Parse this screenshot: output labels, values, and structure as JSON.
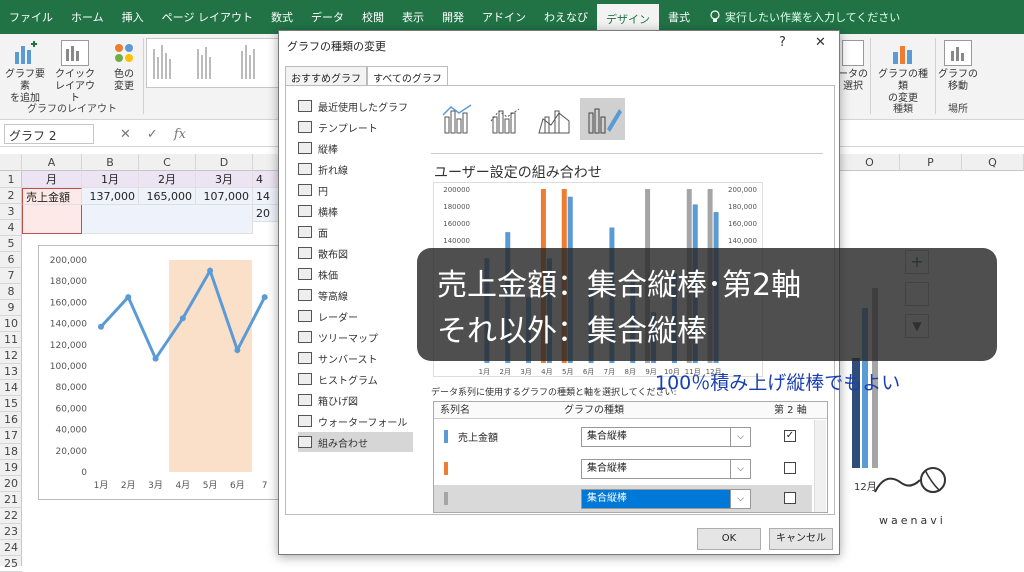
{
  "ribbon": {
    "tabs": [
      "ファイル",
      "ホーム",
      "挿入",
      "ページ レイアウト",
      "数式",
      "データ",
      "校閲",
      "表示",
      "開発",
      "アドイン",
      "わえなび",
      "デザイン",
      "書式"
    ],
    "selected_tab": "デザイン",
    "tell_me": "実行したい作業を入力してください",
    "add_element": "グラフ要素\nを追加",
    "quick_layout": "クイック\nレイアウト",
    "change_colors": "色の\n変更",
    "layout_group": "グラフのレイアウト",
    "select_data_partial": "ータの\n選択",
    "change_type": "グラフの種類\nの変更",
    "type_group": "種類",
    "move_chart": "グラフの\n移動",
    "location_group": "場所"
  },
  "formula_bar": {
    "name_box": "グラフ 2",
    "cancel": "✕",
    "enter": "✓",
    "fx": "fx"
  },
  "sheet": {
    "columns": [
      "A",
      "B",
      "C",
      "D",
      "O",
      "P",
      "Q"
    ],
    "rows": [
      "1",
      "2",
      "3",
      "4",
      "5",
      "6",
      "7",
      "8",
      "9",
      "10",
      "11",
      "12",
      "13",
      "14",
      "15",
      "16",
      "17",
      "18",
      "19",
      "20",
      "21",
      "22",
      "23",
      "24",
      "25"
    ],
    "a1": "月",
    "b1": "1月",
    "c1": "2月",
    "d1": "3月",
    "e1": "4",
    "a2": "売上金額",
    "b2": "137,000",
    "c2": "165,000",
    "d2": "107,000",
    "e2": "14",
    "e3": "20"
  },
  "chart_data": {
    "type": "line",
    "categories": [
      "1月",
      "2月",
      "3月",
      "4月",
      "5月",
      "6月",
      "7"
    ],
    "values": [
      137000,
      165000,
      107000,
      145000,
      190000,
      115000,
      165000
    ],
    "yticks": [
      "200,000",
      "180,000",
      "160,000",
      "140,000",
      "120,000",
      "100,000",
      "80,000",
      "60,000",
      "40,000",
      "20,000",
      "0"
    ],
    "ylim": [
      0,
      200000
    ],
    "highlight_range": [
      "4月",
      "6月"
    ],
    "line_color": "#5b9bd5",
    "highlight_color": "#fbe0c9"
  },
  "dialog": {
    "title": "グラフの種類の変更",
    "help": "?",
    "close": "✕",
    "tabs": [
      "おすすめグラフ",
      "すべてのグラフ"
    ],
    "selected_tab": "すべてのグラフ",
    "nav": [
      {
        "label": "最近使用したグラフ",
        "icon": "undo-icon"
      },
      {
        "label": "テンプレート",
        "icon": "folder-icon"
      },
      {
        "label": "縦棒",
        "icon": "column-chart-icon"
      },
      {
        "label": "折れ線",
        "icon": "line-chart-icon"
      },
      {
        "label": "円",
        "icon": "pie-chart-icon"
      },
      {
        "label": "横棒",
        "icon": "bar-chart-icon"
      },
      {
        "label": "面",
        "icon": "area-chart-icon"
      },
      {
        "label": "散布図",
        "icon": "scatter-chart-icon"
      },
      {
        "label": "株価",
        "icon": "stock-chart-icon"
      },
      {
        "label": "等高線",
        "icon": "surface-chart-icon"
      },
      {
        "label": "レーダー",
        "icon": "radar-chart-icon"
      },
      {
        "label": "ツリーマップ",
        "icon": "treemap-icon"
      },
      {
        "label": "サンバースト",
        "icon": "sunburst-icon"
      },
      {
        "label": "ヒストグラム",
        "icon": "histogram-icon"
      },
      {
        "label": "箱ひげ図",
        "icon": "box-whisker-icon"
      },
      {
        "label": "ウォーターフォール",
        "icon": "waterfall-icon"
      },
      {
        "label": "組み合わせ",
        "icon": "combo-chart-icon"
      }
    ],
    "selected_nav": "組み合わせ",
    "combo_title": "ユーザー設定の組み合わせ",
    "preview_left_ticks": [
      "200000",
      "180000",
      "160000",
      "140000"
    ],
    "preview_right_ticks": [
      "200,000",
      "180,000",
      "160,000",
      "140,000"
    ],
    "preview_months": [
      "1月",
      "2月",
      "3月",
      "4月",
      "5月",
      "6月",
      "7月",
      "8月",
      "9月",
      "10月",
      "11月",
      "12月"
    ],
    "instruction": "データ系列に使用するグラフの種類と軸を選択してください:",
    "table_headers": {
      "name": "系列名",
      "type": "グラフの種類",
      "axis": "第 2 軸"
    },
    "series": [
      {
        "name": "売上金額",
        "color": "#5b9bd5",
        "type": "集合縦棒",
        "secondary": "✓"
      },
      {
        "name": "",
        "color": "#ed7d31",
        "type": "集合縦棒",
        "secondary": ""
      },
      {
        "name": "",
        "color": "#a5a5a5",
        "type": "集合縦棒",
        "secondary": ""
      }
    ],
    "ok": "OK",
    "cancel": "キャンセル"
  },
  "overlay": {
    "line1": "売上金額：集合縦棒･第2軸",
    "line2": "それ以外：集合縦棒",
    "note": "100％積み上げ縦棒でもよい"
  },
  "right_chart": {
    "month_label": "12月"
  },
  "watermark": {
    "text": "waenavi"
  }
}
